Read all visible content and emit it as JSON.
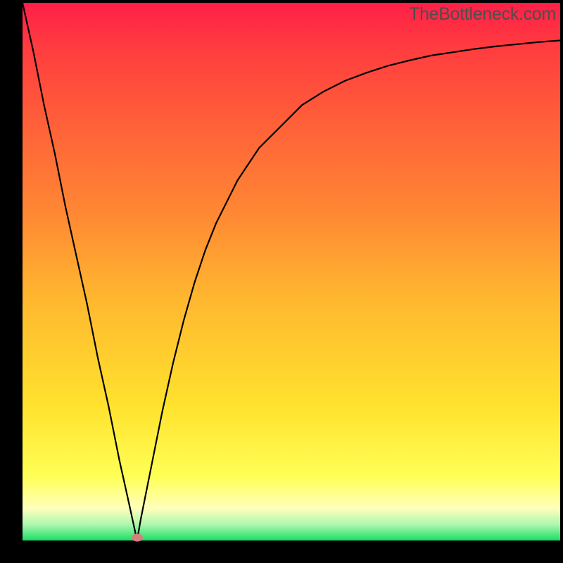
{
  "watermark": "TheBottleneck.com",
  "colors": {
    "frame": "#000000",
    "marker": "#d97d7f",
    "curve": "#000000",
    "gradient_top": "#ff1f48",
    "gradient_bottom": "#1ade65"
  },
  "chart_data": {
    "type": "line",
    "title": "",
    "xlabel": "",
    "ylabel": "",
    "xlim": [
      0,
      100
    ],
    "ylim": [
      0,
      100
    ],
    "grid": false,
    "series": [
      {
        "name": "bottleneck-curve",
        "x": [
          0,
          2,
          4,
          6,
          8,
          10,
          12,
          14,
          16,
          18,
          20,
          21.3,
          22,
          24,
          26,
          28,
          30,
          32,
          34,
          36,
          38,
          40,
          44,
          48,
          52,
          56,
          60,
          64,
          68,
          72,
          76,
          80,
          84,
          88,
          92,
          96,
          100
        ],
        "y": [
          100,
          91,
          81,
          72,
          62,
          53,
          44,
          34,
          25,
          15,
          6,
          0,
          4,
          14,
          24,
          33,
          41,
          48,
          54,
          59,
          63,
          67,
          73,
          77,
          81,
          83.5,
          85.5,
          87.0,
          88.3,
          89.3,
          90.2,
          90.8,
          91.4,
          91.9,
          92.3,
          92.7,
          93
        ]
      }
    ],
    "annotations": [
      {
        "name": "min-marker",
        "x": 21.3,
        "y": 0.5
      }
    ]
  }
}
